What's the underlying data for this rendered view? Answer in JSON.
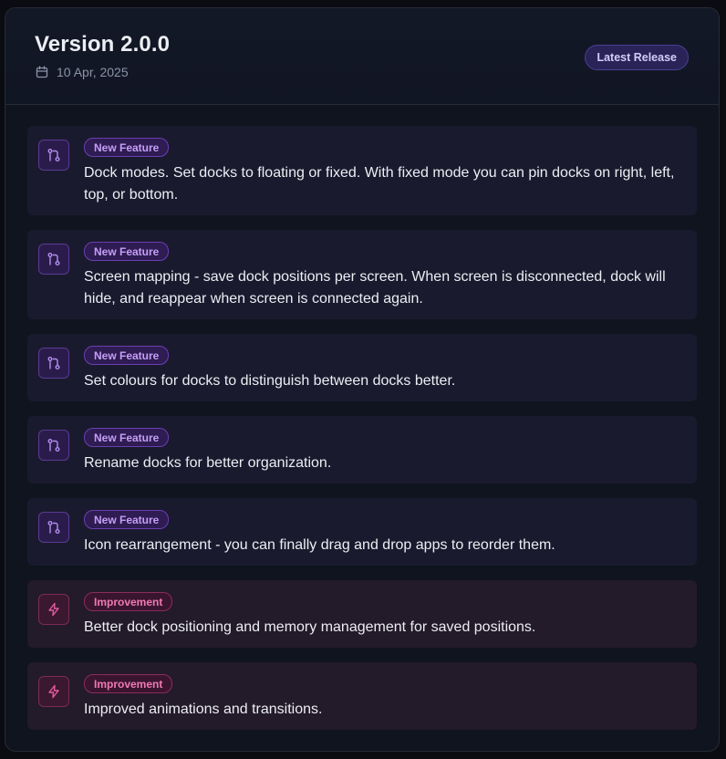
{
  "release": {
    "version": "Version 2.0.0",
    "date": "10 Apr, 2025",
    "badge": "Latest Release"
  },
  "entries": [
    {
      "type": "feature",
      "icon": "git-pull-request-icon",
      "tag": "New Feature",
      "text": "Dock modes. Set docks to floating or fixed. With fixed mode you can pin docks on right, left, top, or bottom."
    },
    {
      "type": "feature",
      "icon": "git-pull-request-icon",
      "tag": "New Feature",
      "text": "Screen mapping - save dock positions per screen. When screen is disconnected, dock will hide, and reappear when screen is connected again."
    },
    {
      "type": "feature",
      "icon": "git-pull-request-icon",
      "tag": "New Feature",
      "text": "Set colours for docks to distinguish between docks better."
    },
    {
      "type": "feature",
      "icon": "git-pull-request-icon",
      "tag": "New Feature",
      "text": "Rename docks for better organization."
    },
    {
      "type": "feature",
      "icon": "git-pull-request-icon",
      "tag": "New Feature",
      "text": "Icon rearrangement - you can finally drag and drop apps to reorder them."
    },
    {
      "type": "improvement",
      "icon": "lightning-bolt-icon",
      "tag": "Improvement",
      "text": "Better dock positioning and memory management for saved positions."
    },
    {
      "type": "improvement",
      "icon": "lightning-bolt-icon",
      "tag": "Improvement",
      "text": "Improved animations and transitions."
    }
  ],
  "colors": {
    "feature_accent": "#c59ef7",
    "improvement_accent": "#f07ab3",
    "badge_bg": "#2a2358"
  }
}
